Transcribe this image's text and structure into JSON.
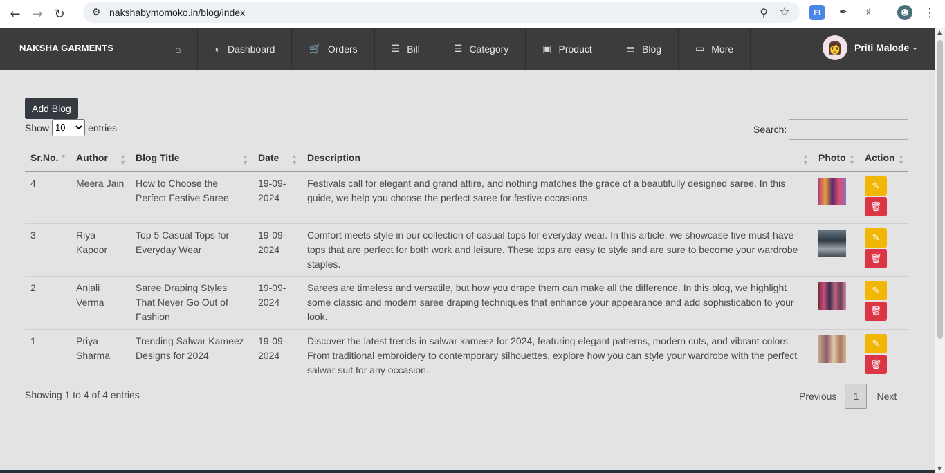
{
  "browser": {
    "url": "nakshabymomoko.in/blog/index",
    "ext_fl": "Fl"
  },
  "navbar": {
    "brand": "NAKSHA GARMENTS",
    "items": [
      {
        "label": "Dashboard",
        "icon": "gauge-icon"
      },
      {
        "label": "Orders",
        "icon": "cart-icon"
      },
      {
        "label": "Bill",
        "icon": "list-icon"
      },
      {
        "label": "Category",
        "icon": "list-icon"
      },
      {
        "label": "Product",
        "icon": "box-icon"
      },
      {
        "label": "Blog",
        "icon": "newspaper-icon"
      },
      {
        "label": "More",
        "icon": "monitor-icon"
      }
    ],
    "user_name": "Priti Malode"
  },
  "content": {
    "add_button": "Add Blog",
    "show_label": "Show",
    "entries_label": "entries",
    "page_length": "10",
    "search_label": "Search:",
    "search_value": ""
  },
  "table": {
    "headers": [
      "Sr.No.",
      "Author",
      "Blog Title",
      "Date",
      "Description",
      "Photo",
      "Action"
    ],
    "rows": [
      {
        "sr": "4",
        "author": "Meera Jain",
        "title": "How to Choose the Perfect Festive Saree",
        "date": "19-09-2024",
        "description": "Festivals call for elegant and grand attire, and nothing matches the grace of a beautifully designed saree. In this guide, we help you choose the perfect saree for festive occasions."
      },
      {
        "sr": "3",
        "author": "Riya Kapoor",
        "title": "Top 5 Casual Tops for Everyday Wear",
        "date": "19-09-2024",
        "description": "Comfort meets style in our collection of casual tops for everyday wear. In this article, we showcase five must-have tops that are perfect for both work and leisure. These tops are easy to style and are sure to become your wardrobe staples."
      },
      {
        "sr": "2",
        "author": "Anjali Verma",
        "title": "Saree Draping Styles That Never Go Out of Fashion",
        "date": "19-09-2024",
        "description": "Sarees are timeless and versatile, but how you drape them can make all the difference. In this blog, we highlight some classic and modern saree draping techniques that enhance your appearance and add sophistication to your look."
      },
      {
        "sr": "1",
        "author": "Priya Sharma",
        "title": "Trending Salwar Kameez Designs for 2024",
        "date": "19-09-2024",
        "description": "Discover the latest trends in salwar kameez for 2024, featuring elegant patterns, modern cuts, and vibrant colors. From traditional embroidery to contemporary silhouettes, explore how you can style your wardrobe with the perfect salwar suit for any occasion."
      }
    ]
  },
  "footer": {
    "info": "Showing 1 to 4 of 4 entries",
    "previous": "Previous",
    "current_page": "1",
    "next": "Next"
  },
  "colors": {
    "navbar": "#3c3c3c",
    "edit_button": "#f2b705",
    "delete_button": "#dc3545",
    "add_button": "#343a40"
  }
}
